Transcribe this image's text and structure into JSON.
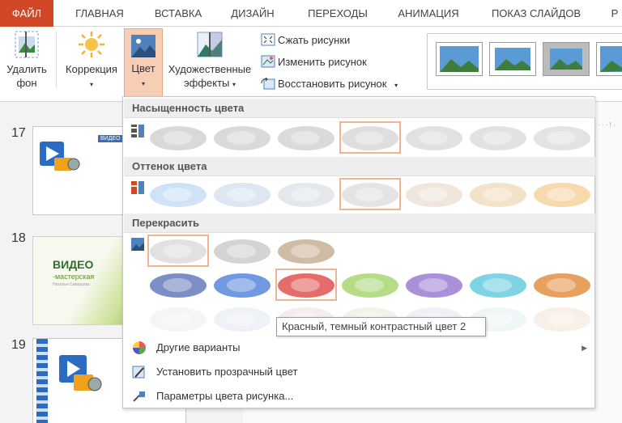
{
  "tabs": [
    {
      "label": "ФАЙЛ"
    },
    {
      "label": "ГЛАВНАЯ"
    },
    {
      "label": "ВСТАВКА"
    },
    {
      "label": "ДИЗАЙН"
    },
    {
      "label": "ПЕРЕХОДЫ"
    },
    {
      "label": "АНИМАЦИЯ"
    },
    {
      "label": "ПОКАЗ СЛАЙДОВ"
    },
    {
      "label": "Р"
    }
  ],
  "ribbon": {
    "remove_bg_line1": "Удалить",
    "remove_bg_line2": "фон",
    "correction": "Коррекция",
    "color": "Цвет",
    "artistic_line1": "Художественные",
    "artistic_line2": "эффекты",
    "compress": "Сжать рисунки",
    "change": "Изменить рисунок",
    "reset": "Восстановить рисунок"
  },
  "slides": [
    {
      "number": "17",
      "badge": "ВИДЕО"
    },
    {
      "number": "18",
      "title": "ВИДЕО",
      "subtitle": "-мастерская",
      "author": "Наталья Скворцова"
    },
    {
      "number": "19"
    }
  ],
  "dropdown": {
    "saturation_title": "Насыщенность цвета",
    "tone_title": "Оттенок цвета",
    "recolor_title": "Перекрасить",
    "saturation": [
      "#d9d9d9",
      "#dadada",
      "#dadada",
      "#dedede",
      "#e1e1e1",
      "#e2e2e2",
      "#e3e3e3"
    ],
    "tone": [
      "#cfe2f8",
      "#dde6f1",
      "#e4e8ec",
      "#e4e4e4",
      "#efe6dc",
      "#f3e2ca",
      "#f7d9ae"
    ],
    "recolor_row1": [
      "#e1e1e1",
      "#d4d4d4",
      "#d0bca4"
    ],
    "recolor_row2": [
      "#7b8fc6",
      "#6f99e0",
      "#e46d6b",
      "#b6dc87",
      "#aa8fd9",
      "#7fd4e4",
      "#e8a05e"
    ],
    "recolor_row3": [
      "#f5f5f5",
      "#eef1f6",
      "#f6ecec",
      "#eef4ea",
      "#f1eef6",
      "#eef6f8",
      "#f8efe6"
    ],
    "tooltip": "Красный, темный контрастный цвет 2",
    "more_variants": "Другие варианты",
    "set_transparent": "Установить прозрачный цвет",
    "picture_color_options": "Параметры цвета рисунка..."
  },
  "colors": {
    "file_tab": "#d24726",
    "selected_button_bg": "#f7cdb4",
    "selected_swatch_border": "#f3b393"
  }
}
